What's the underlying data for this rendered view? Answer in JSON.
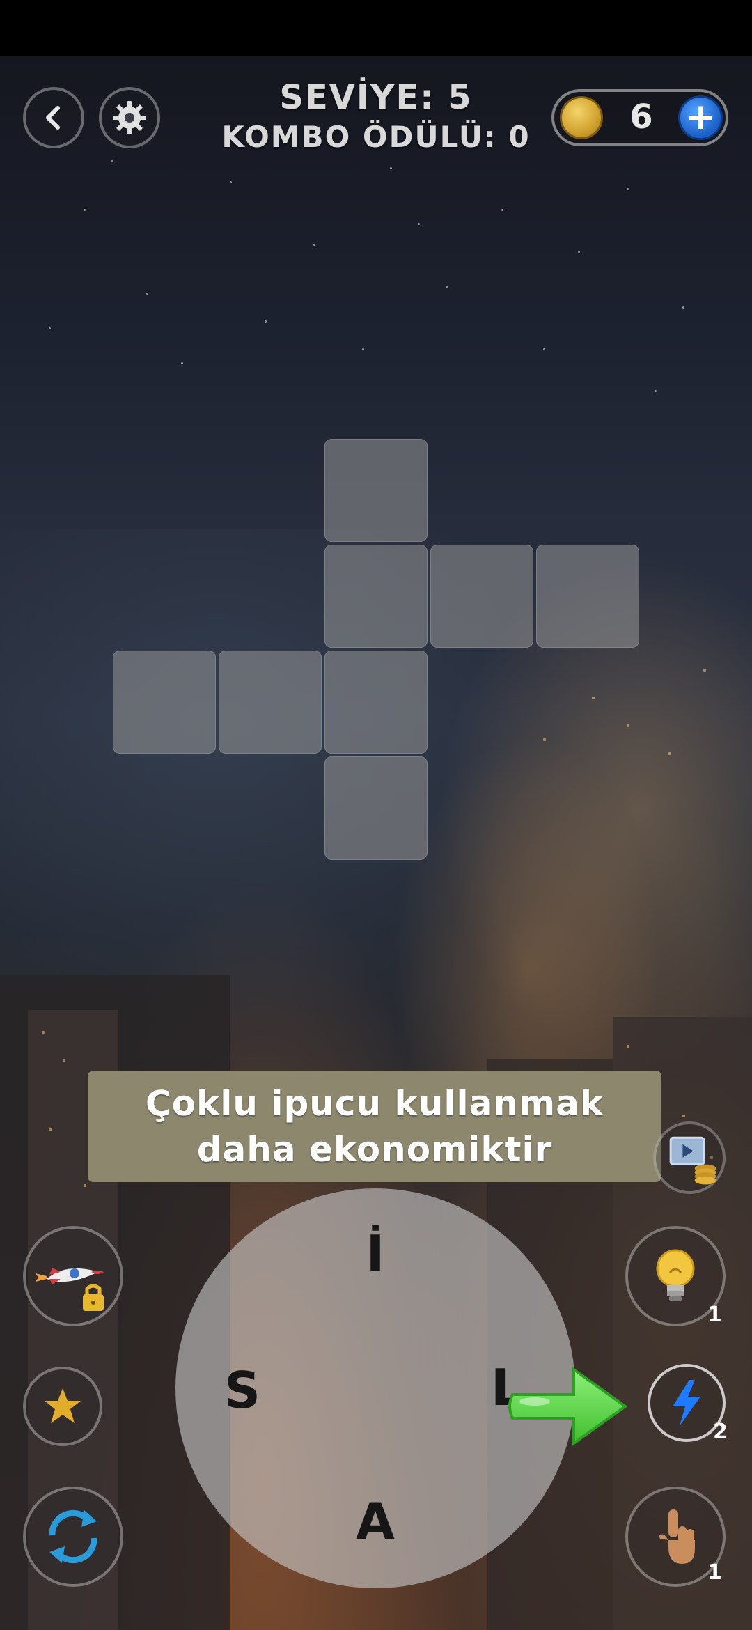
{
  "header": {
    "level_label": "SEVİYE: 5",
    "combo_label": "KOMBO ÖDÜLÜ: 0",
    "coins": "6"
  },
  "icons": {
    "back": "back-arrow-icon",
    "settings": "gear-icon",
    "coin": "coin-icon",
    "add_coins": "plus-icon"
  },
  "tip": {
    "line1": "Çoklu ipucu kullanmak",
    "line2": "daha ekonomiktir"
  },
  "wheel": {
    "letters": [
      "İ",
      "S",
      "L",
      "A"
    ]
  },
  "powerups": {
    "video_coins": "video-coin-icon",
    "hint_count": "1",
    "lightning_count": "2",
    "finger_count": "1",
    "rocket_locked": "rocket-lock-icon",
    "star": "star-icon",
    "shuffle": "shuffle-icon"
  },
  "colors": {
    "tip_bg": "#8c876d",
    "coin_gold": "#d4a634",
    "plus_blue": "#1c5fc7",
    "arrow_green": "#5ed74a",
    "lightning_blue": "#1e7bff"
  }
}
